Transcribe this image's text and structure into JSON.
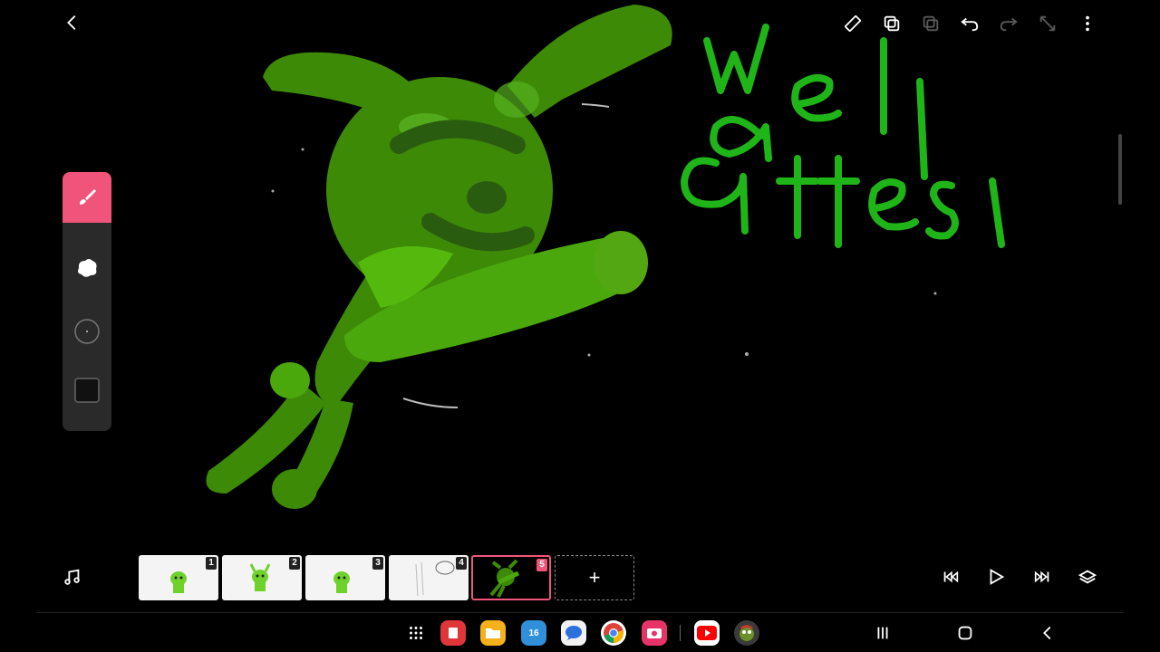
{
  "header": {
    "icons": [
      "back-icon",
      "ruler-icon",
      "copy-layer-icon",
      "paste-layer-icon",
      "undo-icon",
      "redo-icon",
      "expand-icon",
      "more-vert-icon"
    ]
  },
  "canvas": {
    "handwriting": "well ates!",
    "colors": {
      "body": "#3d9a0a",
      "highlight": "#5bc40f",
      "shadow": "#2a5f10",
      "text": "#1fb518"
    }
  },
  "toolbox": {
    "tools": [
      "brush-icon",
      "eraser-icon",
      "brush-size-icon",
      "color-swatch-icon"
    ],
    "active_color": "#f0547a"
  },
  "timeline": {
    "frames": [
      {
        "number": "1"
      },
      {
        "number": "2"
      },
      {
        "number": "3"
      },
      {
        "number": "4"
      },
      {
        "number": "5"
      }
    ],
    "current_frame": "5",
    "add_label": "+",
    "controls": [
      "music-icon",
      "skip-back-icon",
      "play-icon",
      "skip-forward-icon",
      "onion-skin-icon"
    ]
  },
  "navbar": {
    "apps": [
      "app-drawer-icon",
      "notes-app-icon",
      "files-app-icon",
      "calendar-app-icon",
      "messages-app-icon",
      "chrome-app-icon",
      "camera-app-icon",
      "youtube-app-icon",
      "game-app-icon"
    ],
    "calendar_day": "16",
    "system": [
      "recents-icon",
      "home-icon",
      "back-nav-icon"
    ]
  }
}
